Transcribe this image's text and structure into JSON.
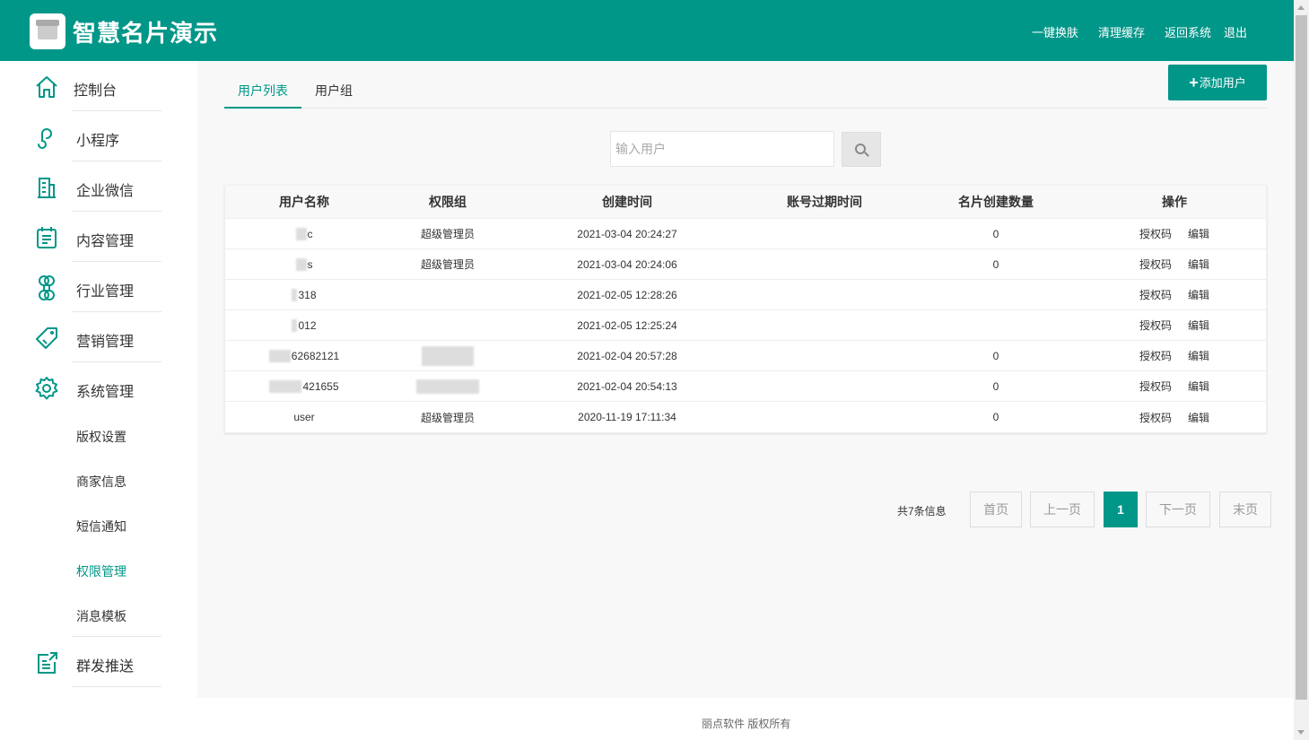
{
  "header": {
    "brand": "智慧名片演示",
    "links": [
      "一键换肤",
      "清理缓存",
      "返回系统",
      "退出"
    ]
  },
  "sidebar": {
    "items": [
      {
        "label": "控制台",
        "icon": "home-icon"
      },
      {
        "label": "小程序",
        "icon": "miniprogram-icon"
      },
      {
        "label": "企业微信",
        "icon": "building-icon"
      },
      {
        "label": "内容管理",
        "icon": "clipboard-icon"
      },
      {
        "label": "行业管理",
        "icon": "command-icon"
      },
      {
        "label": "营销管理",
        "icon": "tag-icon"
      },
      {
        "label": "系统管理",
        "icon": "gear-icon"
      }
    ],
    "sub_items": [
      "版权设置",
      "商家信息",
      "短信通知",
      "权限管理",
      "消息模板"
    ],
    "active_sub": "权限管理",
    "last_item": {
      "label": "群发推送",
      "icon": "export-icon"
    }
  },
  "tabs": [
    "用户列表",
    "用户组"
  ],
  "add_button": "添加用户",
  "search": {
    "placeholder": "输入用户"
  },
  "table": {
    "headers": [
      "用户名称",
      "权限组",
      "创建时间",
      "账号过期时间",
      "名片创建数量",
      "操作"
    ],
    "rows": [
      {
        "name": "c",
        "group": "超级管理员",
        "created": "2021-03-04 20:24:27",
        "expire": "",
        "count": "0"
      },
      {
        "name": "s",
        "group": "超级管理员",
        "created": "2021-03-04 20:24:06",
        "expire": "",
        "count": "0"
      },
      {
        "name": "318",
        "group": "",
        "created": "2021-02-05 12:28:26",
        "expire": "",
        "count": ""
      },
      {
        "name": "012",
        "group": "",
        "created": "2021-02-05 12:25:24",
        "expire": "",
        "count": ""
      },
      {
        "name": "62682121",
        "group": "",
        "created": "2021-02-04 20:57:28",
        "expire": "",
        "count": "0"
      },
      {
        "name": "421655",
        "group": "",
        "created": "2021-02-04 20:54:13",
        "expire": "",
        "count": "0"
      },
      {
        "name": "user",
        "group": "超级管理员",
        "created": "2020-11-19 17:11:34",
        "expire": "",
        "count": "0"
      }
    ],
    "actions": [
      "授权码",
      "编辑"
    ]
  },
  "pagination": {
    "total": "共7条信息",
    "first": "首页",
    "prev": "上一页",
    "current": "1",
    "next": "下一页",
    "last": "末页"
  },
  "footer": "丽点软件 版权所有",
  "colors": {
    "primary": "#009688"
  }
}
